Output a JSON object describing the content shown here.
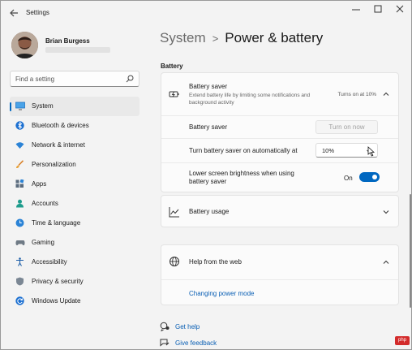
{
  "window": {
    "title": "Settings",
    "icons": {
      "back": "back-arrow-icon",
      "minimize": "minimize-icon",
      "maximize": "maximize-icon",
      "close": "close-icon"
    }
  },
  "profile": {
    "name": "Brian Burgess"
  },
  "search": {
    "placeholder": "Find a setting",
    "value": ""
  },
  "nav": {
    "items": [
      {
        "label": "System",
        "icon": "monitor-icon",
        "active": true
      },
      {
        "label": "Bluetooth & devices",
        "icon": "bluetooth-icon"
      },
      {
        "label": "Network & internet",
        "icon": "wifi-icon"
      },
      {
        "label": "Personalization",
        "icon": "brush-icon"
      },
      {
        "label": "Apps",
        "icon": "apps-icon"
      },
      {
        "label": "Accounts",
        "icon": "person-icon"
      },
      {
        "label": "Time & language",
        "icon": "globe-clock-icon"
      },
      {
        "label": "Gaming",
        "icon": "gamepad-icon"
      },
      {
        "label": "Accessibility",
        "icon": "accessibility-icon"
      },
      {
        "label": "Privacy & security",
        "icon": "shield-icon"
      },
      {
        "label": "Windows Update",
        "icon": "update-icon"
      }
    ]
  },
  "header": {
    "parent": "System",
    "separator": ">",
    "current": "Power & battery"
  },
  "battery": {
    "section_label": "Battery",
    "saver": {
      "title": "Battery saver",
      "description": "Extend battery life by limiting some notifications and background activity",
      "status": "Turns on at 10%",
      "row1_label": "Battery saver",
      "row1_button": "Turn on now",
      "row2_label": "Turn battery saver on automatically at",
      "row2_value": "10%",
      "row3_label": "Lower screen brightness when using battery saver",
      "row3_toggle_label": "On",
      "row3_toggle_on": true
    },
    "usage": {
      "title": "Battery usage"
    }
  },
  "help": {
    "title": "Help from the web",
    "link": "Changing power mode"
  },
  "footer": {
    "get_help": "Get help",
    "give_feedback": "Give feedback"
  },
  "colors": {
    "accent": "#0067c0",
    "link": "#0a5fb4"
  }
}
